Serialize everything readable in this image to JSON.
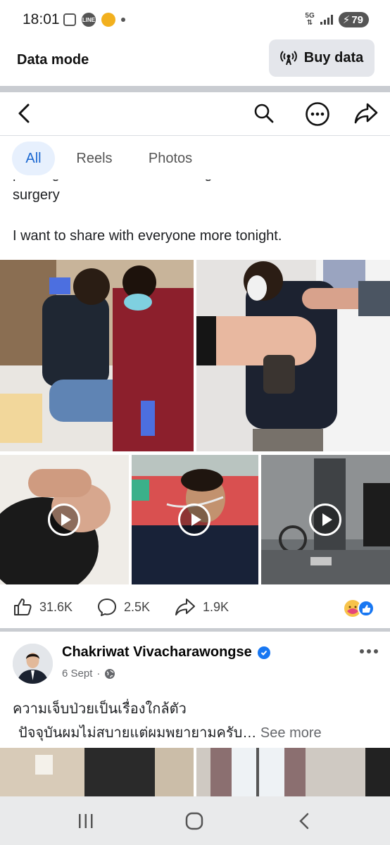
{
  "status_bar": {
    "time": "18:01",
    "network": "5G",
    "battery": "79",
    "icons": [
      "screenshot-icon",
      "line-icon",
      "krungsri-icon",
      "notification-dot"
    ]
  },
  "data_mode": {
    "title": "Data mode",
    "buy_label": "Buy data"
  },
  "nav": {
    "icons": [
      "back-arrow-icon",
      "search-icon",
      "more-icon",
      "share-icon"
    ]
  },
  "tabs": [
    {
      "label": "All",
      "active": true
    },
    {
      "label": "Reels",
      "active": false
    },
    {
      "label": "Photos",
      "active": false
    }
  ],
  "post1": {
    "text_partial": "prolong this disease. I am in urgent need of brain",
    "text_line2": "surgery",
    "text_line3": "I want to share with everyone more tonight.",
    "media": [
      {
        "kind": "photo",
        "desc": "man sitting on hospital bed with nurse"
      },
      {
        "kind": "photo",
        "desc": "blood pressure measurement"
      },
      {
        "kind": "video"
      },
      {
        "kind": "video"
      },
      {
        "kind": "video"
      }
    ],
    "likes": "31.6K",
    "comments": "2.5K",
    "shares": "1.9K"
  },
  "post2": {
    "author": "Chakriwat Vivacharawongse",
    "date": "6 Sept",
    "line1": "ความเจ็บป่วยเป็นเรื่องใกล้ตัว",
    "line2": "ปัจจุบันผมไม่สบายแต่ผมพยายามครับ…",
    "see_more": "See more"
  },
  "colors": {
    "accent": "#1b68d1",
    "tab_active_bg": "#e7f0fd",
    "divider": "#c9ccd1",
    "verified": "#1877f2"
  }
}
